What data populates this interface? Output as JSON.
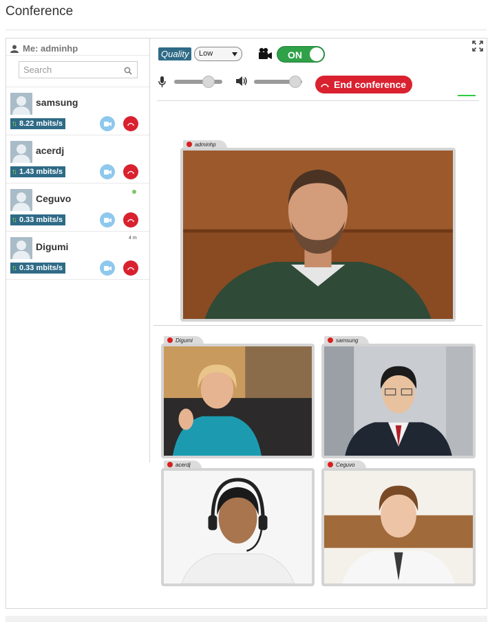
{
  "page": {
    "title": "Conference"
  },
  "sidebar": {
    "me_label": "Me: adminhp",
    "search": {
      "placeholder": "Search",
      "value": ""
    },
    "contacts": [
      {
        "name": "samsung",
        "bandwidth": "8.22 mbits/s",
        "online": false,
        "idle": ""
      },
      {
        "name": "acerdj",
        "bandwidth": "1.43 mbits/s",
        "online": false,
        "idle": ""
      },
      {
        "name": "Ceguvo",
        "bandwidth": "0.33 mbits/s",
        "online": true,
        "idle": ""
      },
      {
        "name": "Digumi",
        "bandwidth": "0.33 mbits/s",
        "online": false,
        "idle": "4 m"
      }
    ]
  },
  "controls": {
    "quality_label": "Quality",
    "quality_value": "Low",
    "camera_toggle": "ON",
    "end_conference": "End conference",
    "mic_level": 0.72,
    "speaker_level": 0.85
  },
  "tiles": {
    "main": {
      "label": "adminhp"
    },
    "grid": [
      {
        "label": "Digumi"
      },
      {
        "label": "samsung"
      },
      {
        "label": "acerdj"
      },
      {
        "label": "Ceguvo"
      }
    ]
  },
  "colors": {
    "accent_blue": "#2f6b87",
    "end_red": "#d92130",
    "toggle_green": "#2fa149",
    "video_blue": "#8ec8ec"
  },
  "icons": {
    "user": "user-icon",
    "search": "search-icon",
    "camera": "video-camera-icon",
    "mic": "microphone-icon",
    "speaker": "speaker-icon",
    "hangup": "phone-hangup-icon",
    "expand": "expand-icon"
  }
}
